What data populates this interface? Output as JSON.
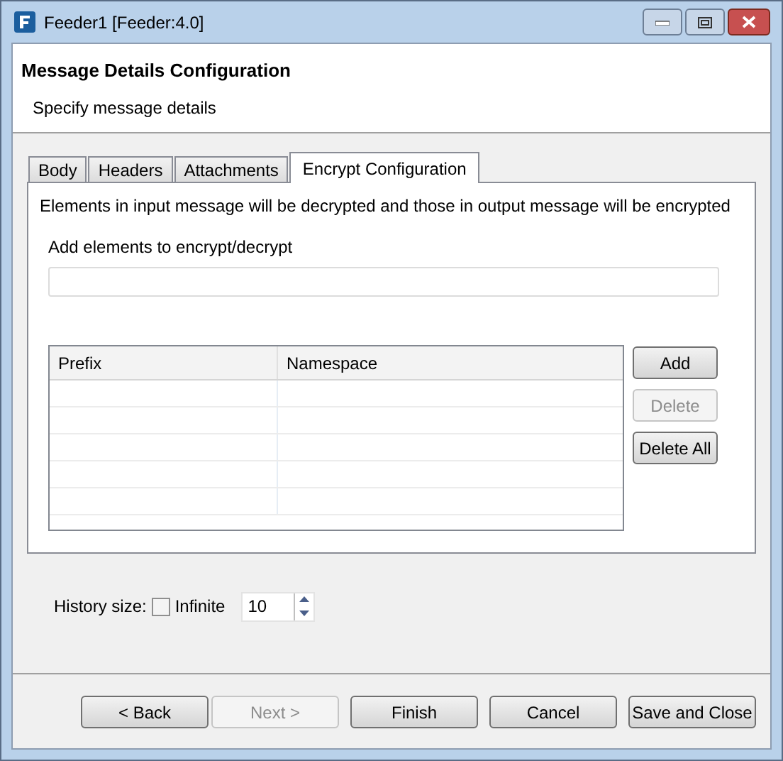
{
  "window": {
    "title": "Feeder1 [Feeder:4.0]"
  },
  "header": {
    "title": "Message Details Configuration",
    "subtitle": "Specify message details"
  },
  "tabs": [
    {
      "label": "Body",
      "selected": false
    },
    {
      "label": "Headers",
      "selected": false
    },
    {
      "label": "Attachments",
      "selected": false
    },
    {
      "label": "Encrypt Configuration",
      "selected": true
    }
  ],
  "panel": {
    "description": "Elements in input message will be decrypted and those in output message will be encrypted",
    "field_label": "Add elements to encrypt/decrypt",
    "table": {
      "columns": [
        "Prefix",
        "Namespace"
      ]
    },
    "buttons": [
      {
        "label": "Add",
        "disabled": false
      },
      {
        "label": "Delete",
        "disabled": true
      },
      {
        "label": "Delete All",
        "disabled": false
      }
    ]
  },
  "history": {
    "label": "History size:",
    "infinite": {
      "label": "Infinite",
      "checked": false
    },
    "value": "10"
  },
  "footer_buttons": [
    {
      "label": "< Back",
      "disabled": false
    },
    {
      "label": "Next >",
      "disabled": true
    },
    {
      "label": "Finish",
      "disabled": false
    },
    {
      "label": "Cancel",
      "disabled": false
    },
    {
      "label": "Save and Close",
      "disabled": false
    }
  ]
}
